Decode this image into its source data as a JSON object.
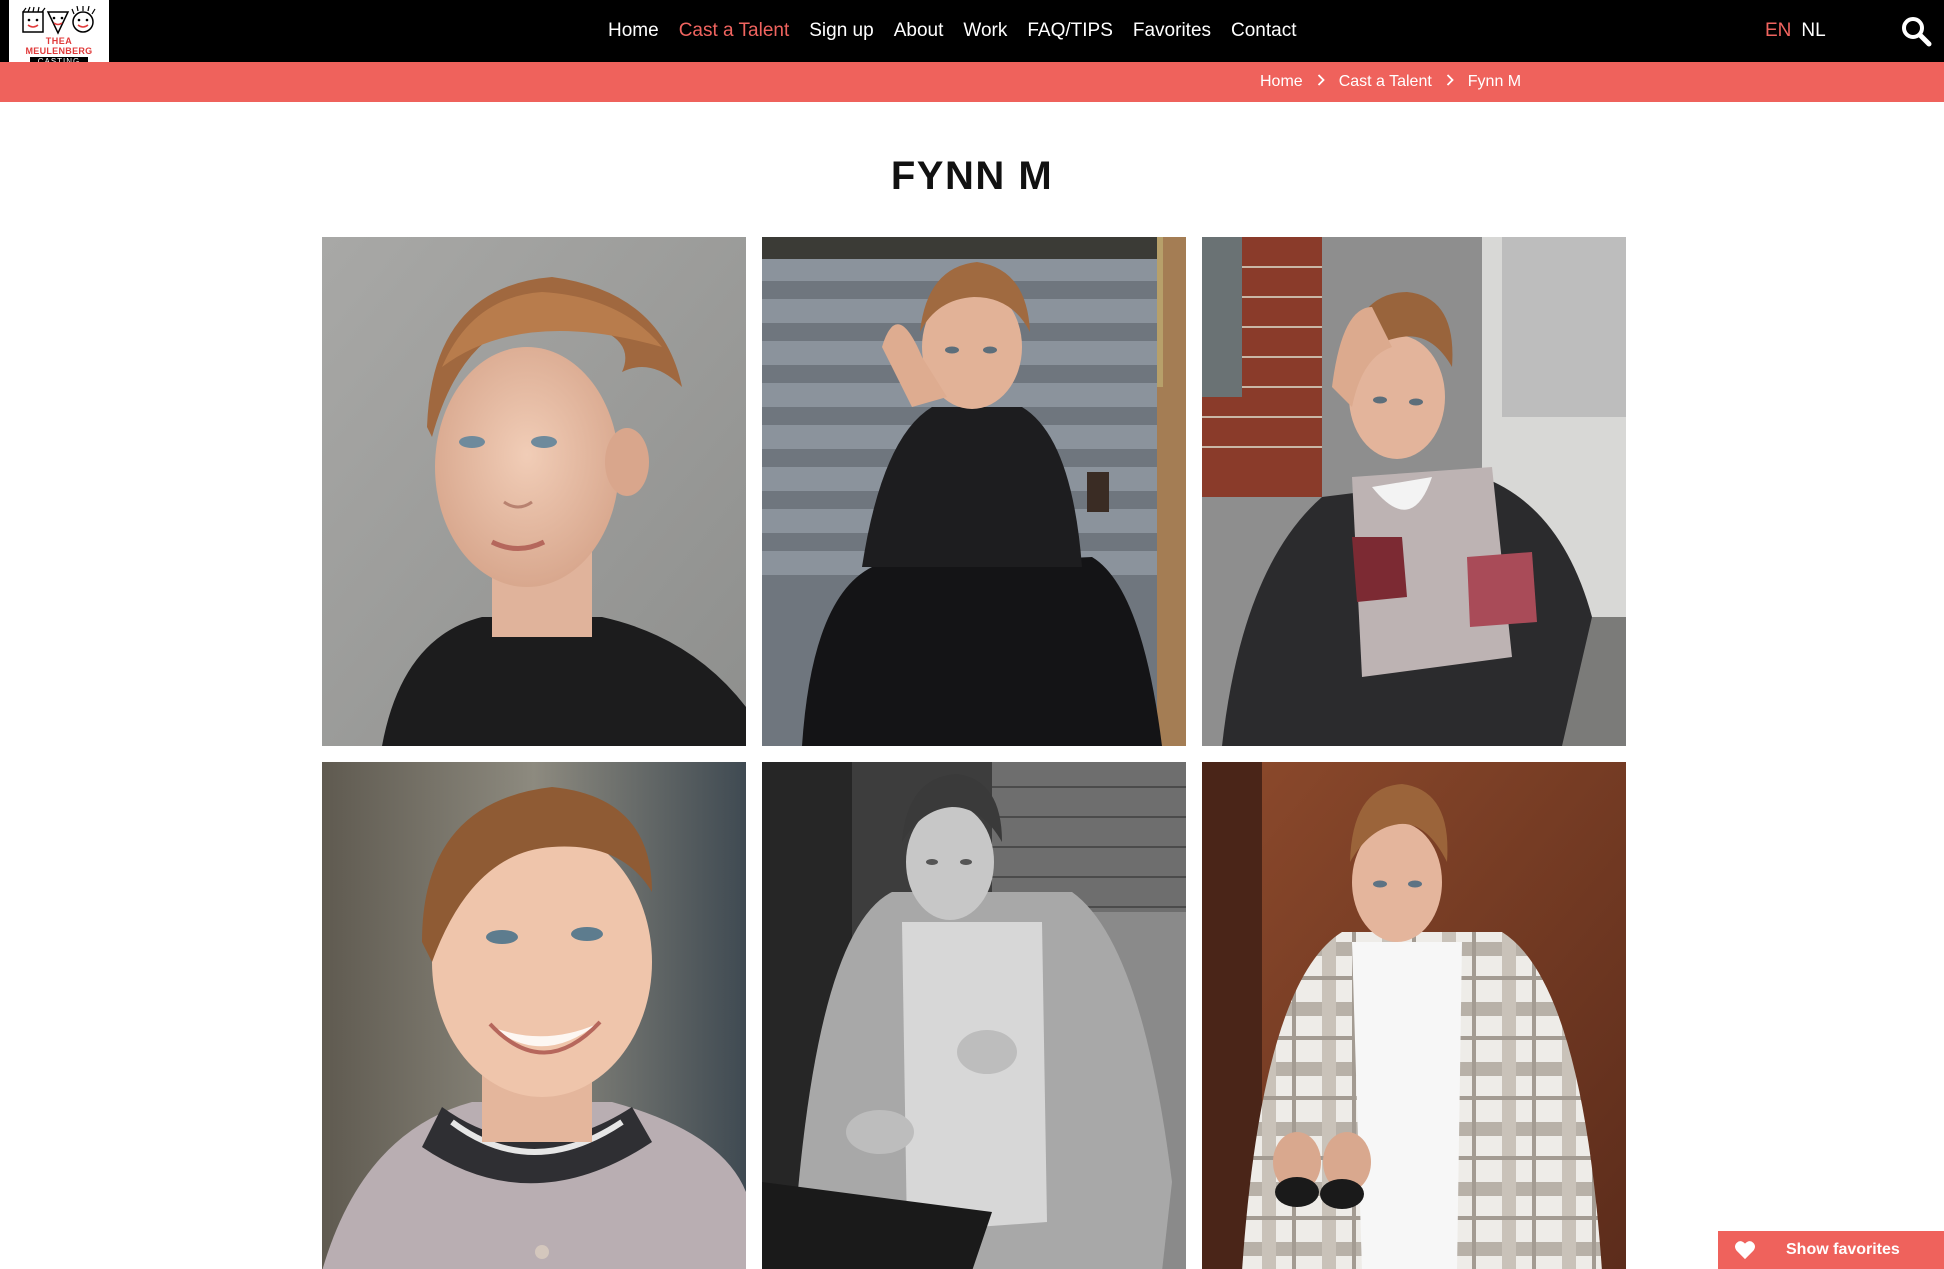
{
  "logo": {
    "line1": "THEA",
    "line2": "MEULENBERG",
    "line3": "CASTING"
  },
  "nav": {
    "items": [
      {
        "label": "Home",
        "active": false
      },
      {
        "label": "Cast a Talent",
        "active": true
      },
      {
        "label": "Sign up",
        "active": false
      },
      {
        "label": "About",
        "active": false
      },
      {
        "label": "Work",
        "active": false
      },
      {
        "label": "FAQ/TIPS",
        "active": false
      },
      {
        "label": "Favorites",
        "active": false
      },
      {
        "label": "Contact",
        "active": false
      }
    ]
  },
  "language": {
    "options": [
      "EN",
      "NL"
    ],
    "selected": "EN"
  },
  "icons": {
    "search": "search-icon",
    "breadcrumb_separator": "chevron-right-icon",
    "favorites": "heart-icon"
  },
  "breadcrumb": [
    "Home",
    "Cast a Talent",
    "Fynn M"
  ],
  "page": {
    "title": "FYNN M"
  },
  "photos": [
    {
      "name": "photo-portrait-grey-wall"
    },
    {
      "name": "photo-sitting-on-steps"
    },
    {
      "name": "photo-varsity-jacket"
    },
    {
      "name": "photo-smiling-closeup"
    },
    {
      "name": "photo-black-and-white"
    },
    {
      "name": "photo-checked-shirt"
    }
  ],
  "favorites_button": {
    "label": "Show favorites"
  },
  "colors": {
    "accent": "#ef625c",
    "header_bg": "#000000",
    "text": "#111111"
  }
}
